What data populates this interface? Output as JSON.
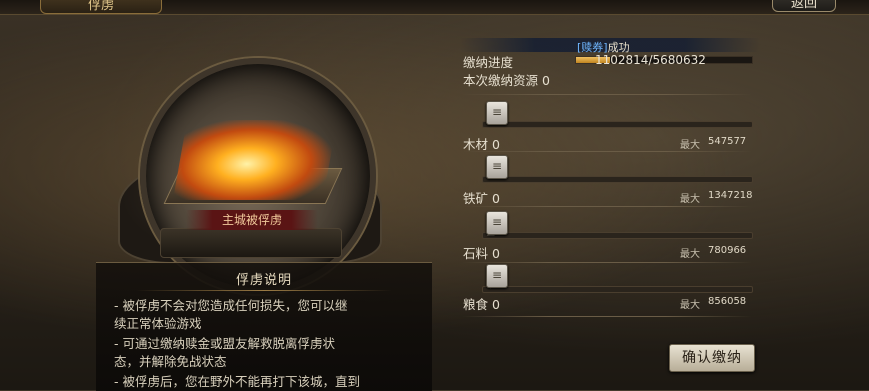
{
  "header": {
    "title": "俘虏",
    "back_label": "返回"
  },
  "orb": {
    "caption": "主城被俘虏"
  },
  "description": {
    "title": "俘虏说明",
    "lines": [
      "- 被俘虏不会对您造成任何损失，您可以继",
      "续正常体验游戏",
      "- 可通过缴纳赎金或盟友解救脱离俘虏状",
      "态，并解除免战状态",
      "- 被俘虏后，您在野外不能再打下该城，直到"
    ]
  },
  "status": {
    "tag": "[赎券]",
    "tag_suffix": "成功",
    "progress_label": "缴纳进度",
    "progress_current": "1102814",
    "progress_total": "5680632",
    "progress_text": "1102814/5680632",
    "progress_fraction": 0.194,
    "resources_label": "本次缴纳资源",
    "resources_value": "0"
  },
  "resources": [
    {
      "name": "木材",
      "value": "0",
      "max_label": "最大",
      "max_value": "547577",
      "icon": "wood-icon"
    },
    {
      "name": "铁矿",
      "value": "0",
      "max_label": "最大",
      "max_value": "1347218",
      "icon": "iron-icon"
    },
    {
      "name": "石料",
      "value": "0",
      "max_label": "最大",
      "max_value": "780966",
      "icon": "stone-icon"
    },
    {
      "name": "粮食",
      "value": "0",
      "max_label": "最大",
      "max_value": "856058",
      "icon": "grain-icon"
    }
  ],
  "confirm_label": "确认缴纳"
}
